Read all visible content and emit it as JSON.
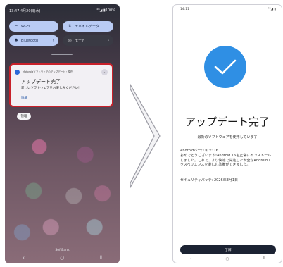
{
  "left": {
    "status": {
      "time_date": "13:47  4月20日(木)",
      "icons": "⁴ᴳ◢ ▮100%"
    },
    "tiles": [
      {
        "label": "Wi-Fi",
        "icon": "wifi-icon",
        "glyph": "⌔",
        "arrow": ""
      },
      {
        "label": "モバイルデータ",
        "icon": "data-icon",
        "glyph": "⇅",
        "arrow": ""
      },
      {
        "label": "Bluetooth",
        "icon": "bluetooth-icon",
        "glyph": "✱",
        "arrow": "›"
      },
      {
        "label": "モード",
        "icon": "mode-icon",
        "glyph": "◎",
        "arrow": "›"
      }
    ],
    "notification": {
      "meta": "Motorolaソフトウェアのアップデート・現在",
      "expand_glyph": "︿",
      "title": "アップデート完了",
      "body": "新しいソフトウェアをお楽しみください!",
      "action": "詳細"
    },
    "manage_label": "管理",
    "carrier": "SoftBank",
    "nav": {
      "back": "‹",
      "home": "○",
      "recents": "⦀"
    }
  },
  "right": {
    "status": {
      "time": "14:11",
      "icons": "⁴ᴳ◢ ▮"
    },
    "title": "アップデート完了",
    "subtitle": "最新のソフトウェアを使用しています",
    "details": [
      "Androidバージョン: 16",
      "おめでとうございます!Android 16を正常にインストールしました。これで、より快適で先進した安全なAndroidエクスペリエンスを楽しむ準備ができました。",
      "セキュリティパッチ: 2026年3月1日"
    ],
    "done_label": "了解",
    "nav": {
      "back": "‹",
      "home": "○",
      "recents": "⦀"
    }
  },
  "colors": {
    "accent": "#2f8fe4",
    "highlight": "#c8202a",
    "tile_on": "#b9cbf4",
    "button_dark": "#1c2333"
  }
}
